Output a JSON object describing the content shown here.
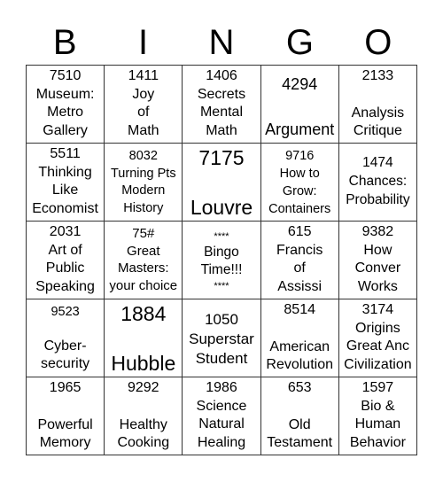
{
  "header": {
    "letters": [
      "B",
      "I",
      "N",
      "G",
      "O"
    ]
  },
  "cells": [
    {
      "lines": [
        "7510",
        "Museum:",
        "Metro",
        "Gallery"
      ]
    },
    {
      "lines": [
        "1411",
        "Joy",
        "of",
        "Math"
      ]
    },
    {
      "lines": [
        "1406",
        "Secrets",
        "Mental",
        "Math"
      ]
    },
    {
      "lines": [
        "4294",
        "Argument"
      ]
    },
    {
      "lines": [
        "2133",
        "Analysis",
        "Critique"
      ]
    },
    {
      "lines": [
        "5511",
        "Thinking",
        "Like",
        "Economist"
      ]
    },
    {
      "lines": [
        "8032",
        "Turning Pts",
        "Modern",
        "History"
      ]
    },
    {
      "lines": [
        "7175",
        "Louvre"
      ]
    },
    {
      "lines": [
        "9716",
        "How to",
        "Grow:",
        "Containers"
      ]
    },
    {
      "lines": [
        "1474",
        "Chances:",
        "Probability"
      ]
    },
    {
      "lines": [
        "2031",
        "Art of",
        "Public",
        "Speaking"
      ]
    },
    {
      "lines": [
        "75#",
        "Great",
        "Masters:",
        "your choice"
      ]
    },
    {
      "lines": [
        "****",
        "Bingo",
        "Time!!!",
        "****"
      ]
    },
    {
      "lines": [
        "615",
        "Francis",
        "of",
        "Assissi"
      ]
    },
    {
      "lines": [
        "9382",
        "How",
        "Conver",
        "Works"
      ]
    },
    {
      "lines": [
        "9523",
        "Cyber-",
        "security"
      ]
    },
    {
      "lines": [
        "1884",
        "Hubble"
      ]
    },
    {
      "lines": [
        "1050",
        "Superstar",
        "Student"
      ]
    },
    {
      "lines": [
        "8514",
        "American",
        "Revolution"
      ]
    },
    {
      "lines": [
        "3174",
        "Origins",
        "Great Anc",
        "Civilization"
      ]
    },
    {
      "lines": [
        "1965",
        "Powerful",
        "Memory"
      ]
    },
    {
      "lines": [
        "9292",
        "Healthy",
        "Cooking"
      ]
    },
    {
      "lines": [
        "1986",
        "Science",
        "Natural",
        "Healing"
      ]
    },
    {
      "lines": [
        "653",
        "Old",
        "Testament"
      ]
    },
    {
      "lines": [
        "1597",
        "Bio &",
        "Human",
        "Behavior"
      ]
    }
  ]
}
